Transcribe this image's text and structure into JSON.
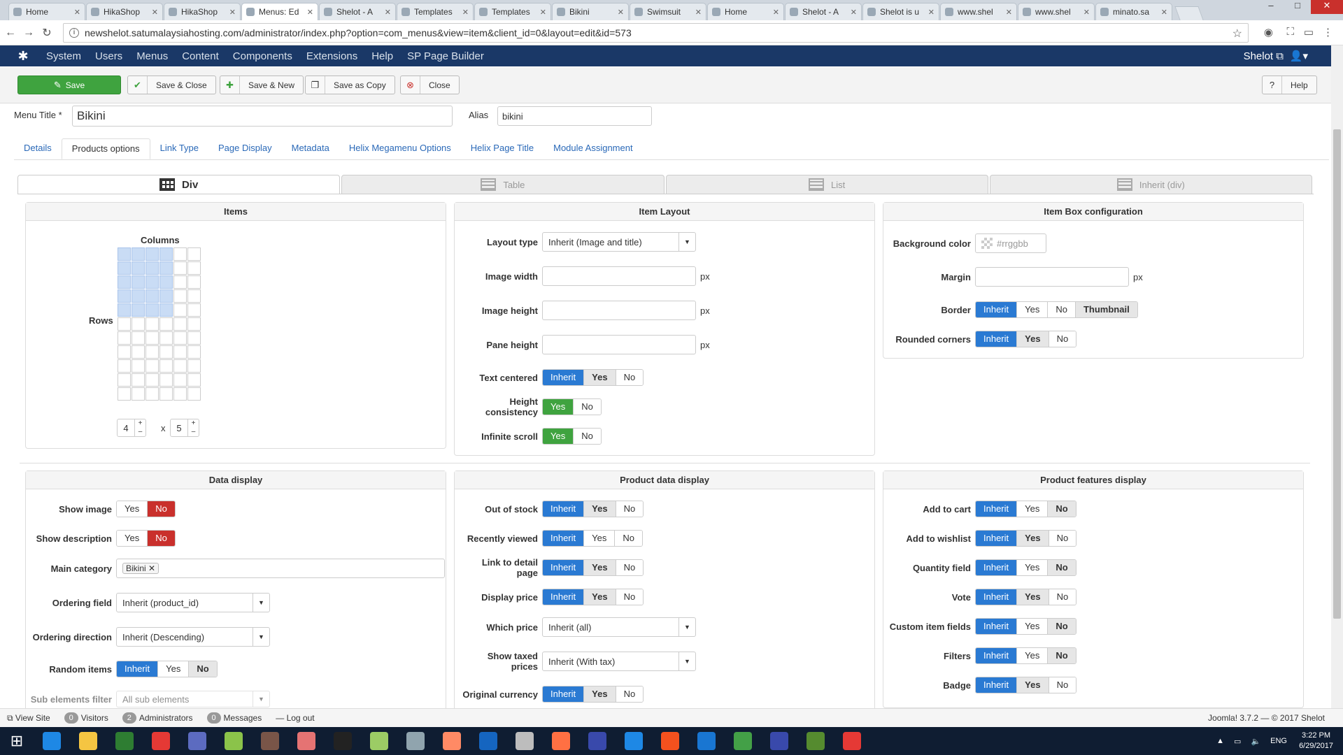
{
  "browser": {
    "tabs": [
      {
        "label": "Home"
      },
      {
        "label": "HikaShop"
      },
      {
        "label": "HikaShop"
      },
      {
        "label": "Menus: Ed"
      },
      {
        "label": "Shelot - A"
      },
      {
        "label": "Templates"
      },
      {
        "label": "Templates"
      },
      {
        "label": "Bikini"
      },
      {
        "label": "Swimsuit"
      },
      {
        "label": "Home"
      },
      {
        "label": "Shelot - A"
      },
      {
        "label": "Shelot is u"
      },
      {
        "label": "www.shel"
      },
      {
        "label": "www.shel"
      },
      {
        "label": "minato.sa"
      }
    ],
    "url": "newshelot.satumalaysiahosting.com/administrator/index.php?option=com_menus&view=item&client_id=0&layout=edit&id=573"
  },
  "menubar": {
    "items": [
      "System",
      "Users",
      "Menus",
      "Content",
      "Components",
      "Extensions",
      "Help",
      "SP Page Builder"
    ],
    "site": "Shelot"
  },
  "toolbar": {
    "save": "Save",
    "save_close": "Save & Close",
    "save_new": "Save & New",
    "save_copy": "Save as Copy",
    "close": "Close",
    "help": "Help"
  },
  "form": {
    "menu_title_label": "Menu Title *",
    "menu_title": "Bikini",
    "alias_label": "Alias",
    "alias": "bikini"
  },
  "form_tabs": [
    "Details",
    "Products options",
    "Link Type",
    "Page Display",
    "Metadata",
    "Helix Megamenu Options",
    "Helix Page Title",
    "Module Assignment"
  ],
  "layout_tabs": [
    "Div",
    "Table",
    "List",
    "Inherit (div)"
  ],
  "items_panel": {
    "title": "Items",
    "columns": "Columns",
    "rows": "Rows",
    "cols_value": "4",
    "rows_value": "5",
    "x": "x",
    "grid_rows": 11,
    "grid_cols": 6,
    "selected_cols": 4,
    "selected_rows": 5
  },
  "item_layout": {
    "title": "Item Layout",
    "layout_type_label": "Layout type",
    "layout_type": "Inherit (Image and title)",
    "image_width": "Image width",
    "image_height": "Image height",
    "pane_height": "Pane height",
    "px": "px",
    "text_centered": "Text centered",
    "height_consistency": "Height consistency",
    "infinite_scroll": "Infinite scroll",
    "inherit": "Inherit",
    "yes": "Yes",
    "no": "No"
  },
  "item_box": {
    "title": "Item Box configuration",
    "bg_label": "Background color",
    "bg_placeholder": "#rrggbb",
    "margin_label": "Margin",
    "px": "px",
    "border_label": "Border",
    "rounded_label": "Rounded corners",
    "inherit": "Inherit",
    "yes": "Yes",
    "no": "No",
    "thumbnail": "Thumbnail"
  },
  "data_display": {
    "title": "Data display",
    "show_image": "Show image",
    "show_description": "Show description",
    "main_category": "Main category",
    "category_tag": "Bikini",
    "ordering_field": "Ordering field",
    "ordering_field_value": "Inherit (product_id)",
    "ordering_direction": "Ordering direction",
    "ordering_direction_value": "Inherit (Descending)",
    "random_items": "Random items",
    "sub_filter": "Sub elements filter",
    "sub_filter_value": "All sub elements",
    "inherit": "Inherit",
    "yes": "Yes",
    "no": "No"
  },
  "product_data": {
    "title": "Product data display",
    "out_of_stock": "Out of stock",
    "recently_viewed": "Recently viewed",
    "link_detail": "Link to detail page",
    "display_price": "Display price",
    "which_price": "Which price",
    "which_price_value": "Inherit (all)",
    "show_taxed": "Show taxed prices",
    "show_taxed_value": "Inherit (With tax)",
    "original_currency": "Original currency",
    "inherit": "Inherit",
    "yes": "Yes",
    "no": "No"
  },
  "product_features": {
    "title": "Product features display",
    "add_to_cart": "Add to cart",
    "add_to_wishlist": "Add to wishlist",
    "quantity_field": "Quantity field",
    "vote": "Vote",
    "custom_fields": "Custom item fields",
    "filters": "Filters",
    "badge": "Badge",
    "inherit": "Inherit",
    "yes": "Yes",
    "no": "No"
  },
  "statusbar": {
    "view_site": "View Site",
    "visitors_count": "0",
    "visitors": "Visitors",
    "admins_count": "2",
    "admins": "Administrators",
    "messages_count": "0",
    "messages": "Messages",
    "logout": "Log out",
    "version": "Joomla! 3.7.2 — © 2017 Shelot"
  },
  "taskbar": {
    "lang": "ENG",
    "time": "3:22 PM",
    "date": "6/29/2017"
  },
  "colors": {
    "menubar": "#1a3867",
    "save": "#3fa33f",
    "inherit_blue": "#2a7ad3",
    "no_red": "#c9302c"
  }
}
